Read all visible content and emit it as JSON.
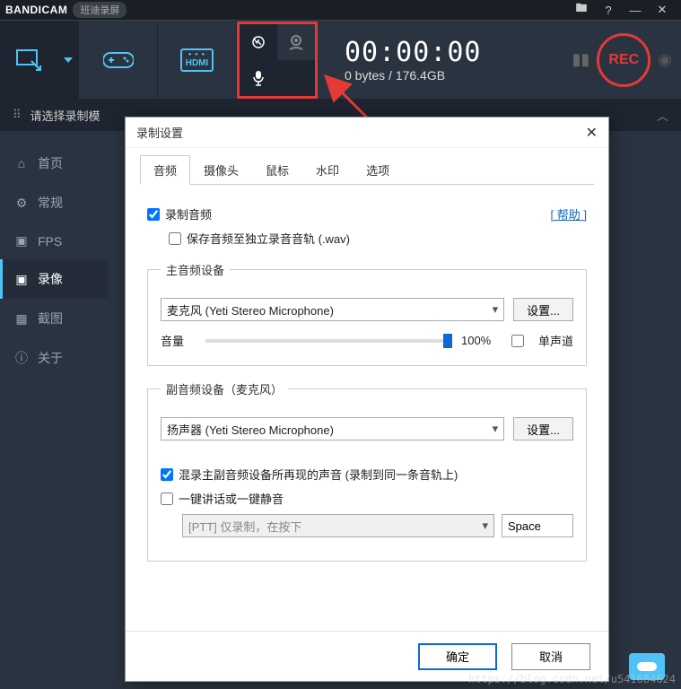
{
  "titlebar": {
    "brand_prefix": "BANDI",
    "brand_suffix": "CAM",
    "subbrand": "班迪录屏"
  },
  "topbar": {
    "hdmi_label": "HDMI",
    "timer": "00:00:00",
    "size_used": "0 bytes",
    "size_sep": " / ",
    "size_total": "176.4GB",
    "rec_label": "REC"
  },
  "mode_row": {
    "label": "请选择录制模"
  },
  "sidebar": {
    "items": [
      {
        "label": "首页"
      },
      {
        "label": "常规"
      },
      {
        "label": "FPS"
      },
      {
        "label": "录像"
      },
      {
        "label": "截图"
      },
      {
        "label": "关于"
      }
    ]
  },
  "dialog": {
    "title": "录制设置",
    "tabs": [
      "音频",
      "摄像头",
      "鼠标",
      "水印",
      "选项"
    ],
    "record_audio": "录制音频",
    "help": "[ 帮助 ]",
    "save_wav": "保存音频至独立录音音轨 (.wav)",
    "primary_legend": "主音频设备",
    "primary_select": "麦克风 (Yeti Stereo Microphone)",
    "settings_btn": "设置...",
    "volume_label": "音量",
    "volume_value": "100%",
    "mono": "单声道",
    "secondary_legend": "副音频设备（麦克风）",
    "secondary_select": "扬声器 (Yeti Stereo Microphone)",
    "mix_checkbox": "混录主副音频设备所再现的声音 (录制到同一条音轨上)",
    "ptt_checkbox": "一键讲话或一键静音",
    "ptt_placeholder": "[PTT] 仅录制，在按下",
    "ptt_hotkey": "Space",
    "ok": "确定",
    "cancel": "取消"
  },
  "watermark": "https://blog.csdn.net/u541684624"
}
